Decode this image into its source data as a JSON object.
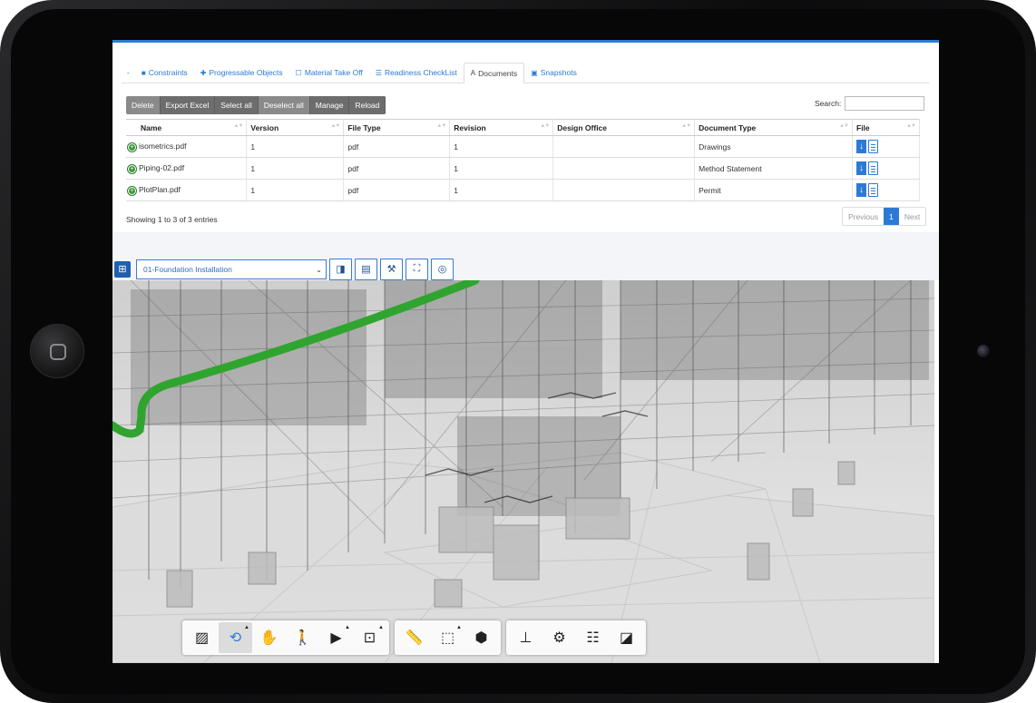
{
  "tabs": [
    {
      "label": "-",
      "icon": "dash"
    },
    {
      "label": "Constraints",
      "icon": "square-icon"
    },
    {
      "label": "Progressable Objects",
      "icon": "puzzle-icon"
    },
    {
      "label": "Material Take Off",
      "icon": "document-icon"
    },
    {
      "label": "Readiness CheckList",
      "icon": "list-icon"
    },
    {
      "label": "Documents",
      "icon": "text-format-icon",
      "active": true
    },
    {
      "label": "Snapshots",
      "icon": "image-icon"
    }
  ],
  "toolbar": {
    "delete": "Delete",
    "export_excel": "Export Excel",
    "select_all": "Select all",
    "deselect_all": "Deselect all",
    "manage": "Manage",
    "reload": "Reload"
  },
  "search": {
    "label": "Search:",
    "value": ""
  },
  "table": {
    "columns": [
      "Name",
      "Version",
      "File Type",
      "Revision",
      "Design Office",
      "Document Type",
      "File"
    ],
    "rows": [
      {
        "name": "isometrics.pdf",
        "version": "1",
        "file_type": "pdf",
        "revision": "1",
        "design_office": "",
        "document_type": "Drawings"
      },
      {
        "name": "Piping-02.pdf",
        "version": "1",
        "file_type": "pdf",
        "revision": "1",
        "design_office": "",
        "document_type": "Method Statement"
      },
      {
        "name": "PlotPlan.pdf",
        "version": "1",
        "file_type": "pdf",
        "revision": "1",
        "design_office": "",
        "document_type": "Permit"
      }
    ]
  },
  "info": "Showing 1 to 3 of 3 entries",
  "pager": {
    "previous": "Previous",
    "current": "1",
    "next": "Next"
  },
  "model": {
    "selected": "01-Foundation Installation"
  },
  "colors": {
    "accent": "#2d7ad6",
    "pipe": "#2fa52f"
  }
}
